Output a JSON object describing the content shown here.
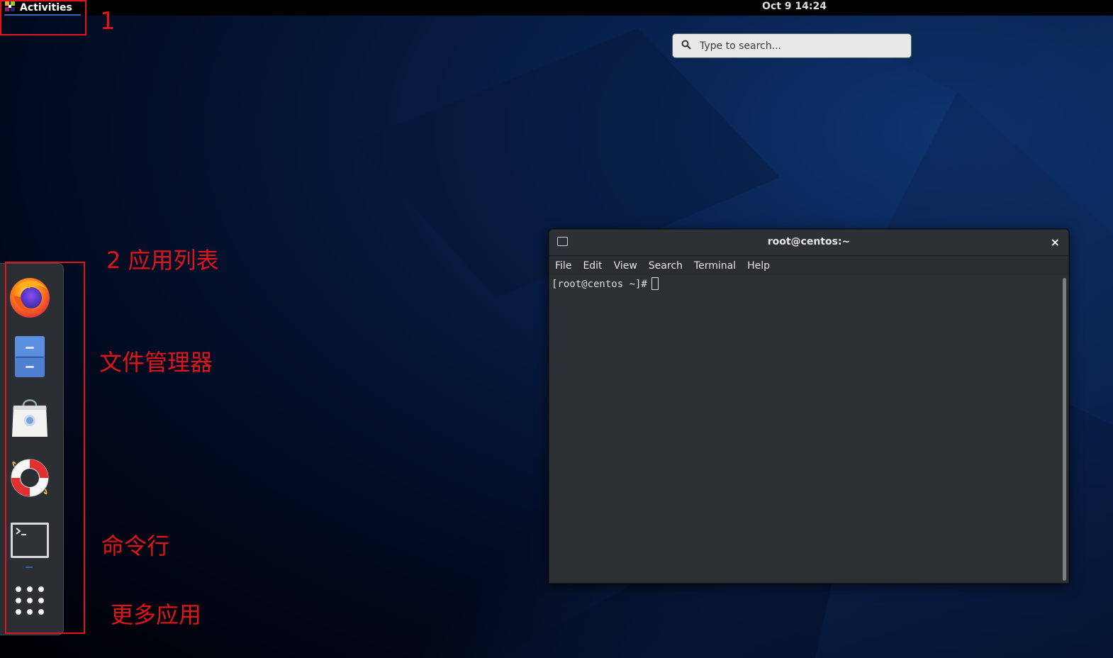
{
  "topbar": {
    "activities_label": "Activities",
    "clock": "Oct 9  14:24"
  },
  "search": {
    "placeholder": "Type to search..."
  },
  "dash": {
    "items": [
      {
        "name": "firefox",
        "icon": "firefox-icon"
      },
      {
        "name": "files",
        "icon": "file-cabinet-icon"
      },
      {
        "name": "software",
        "icon": "software-bag-icon"
      },
      {
        "name": "help",
        "icon": "lifebuoy-icon"
      },
      {
        "name": "terminal",
        "icon": "terminal-icon",
        "running": true
      },
      {
        "name": "show-applications",
        "icon": "grid-dots-icon"
      }
    ]
  },
  "annotations": {
    "n1": "1",
    "n2": "2 应用列表",
    "file_manager": "文件管理器",
    "command_line": "命令行",
    "more_apps": "更多应用"
  },
  "terminal": {
    "title": "root@centos:~",
    "close": "×",
    "menu": [
      "File",
      "Edit",
      "View",
      "Search",
      "Terminal",
      "Help"
    ],
    "prompt": "[root@centos ~]#"
  },
  "colors": {
    "annotation": "#e0151a",
    "accent": "#3465c0",
    "terminal_bg": "#2c2f33"
  }
}
